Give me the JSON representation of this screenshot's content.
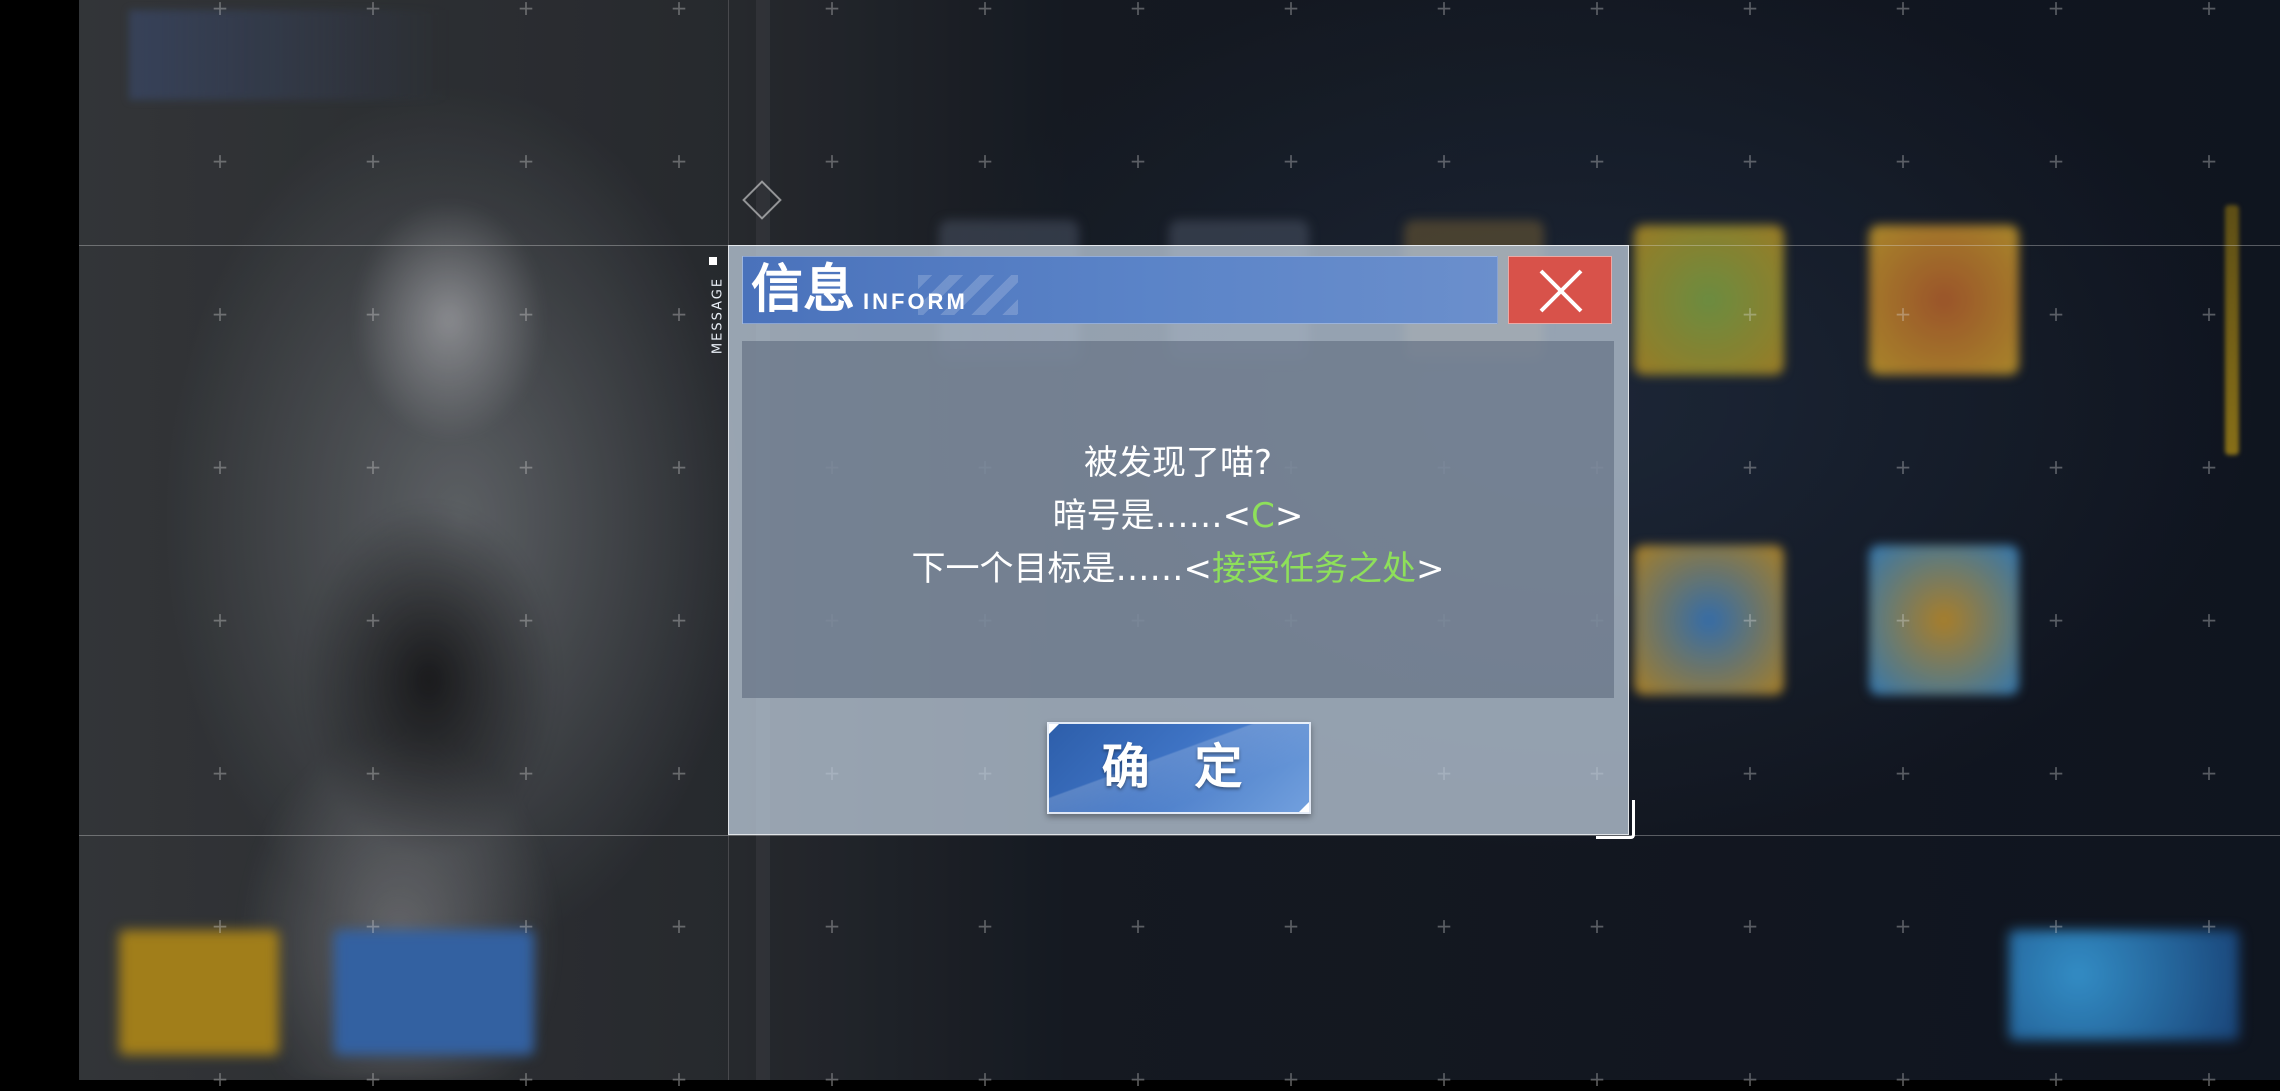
{
  "dialog": {
    "side_label": "MESSAGE",
    "title_cn": "信息",
    "title_en": "INFORM",
    "close_icon": "close-icon",
    "messages": {
      "line1": "被发现了喵?",
      "line2_prefix": "暗号是……<",
      "line2_code": "C",
      "line2_suffix": ">",
      "line3_prefix": "下一个目标是……<",
      "line3_target": "接受任务之处",
      "line3_suffix": ">"
    },
    "confirm_label": "确 定"
  },
  "colors": {
    "title_bar": "#4a72bb",
    "close_button": "#d8524a",
    "highlight_text": "#8ee05a",
    "confirm_button": "#3e73c4"
  }
}
